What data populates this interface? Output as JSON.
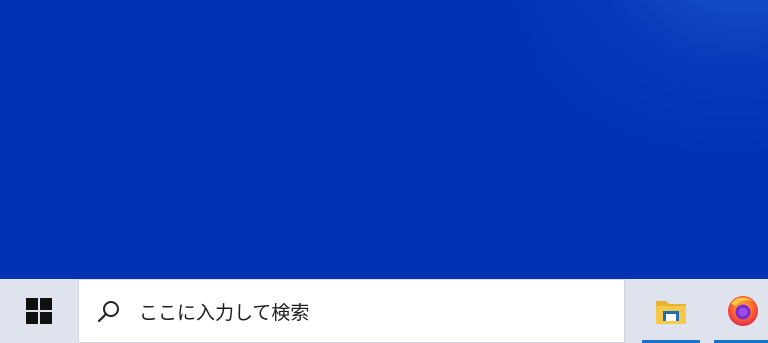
{
  "search": {
    "placeholder": "ここに入力して検索"
  },
  "taskbar": {
    "start_icon": "windows-logo-icon",
    "pinned_apps": [
      {
        "icon": "file-explorer-icon",
        "running": true
      },
      {
        "icon": "firefox-icon",
        "running": true
      }
    ]
  },
  "colors": {
    "desktop_background": "#0033b3",
    "taskbar_background": "#dfe3ee",
    "running_indicator": "#1a73c8"
  }
}
